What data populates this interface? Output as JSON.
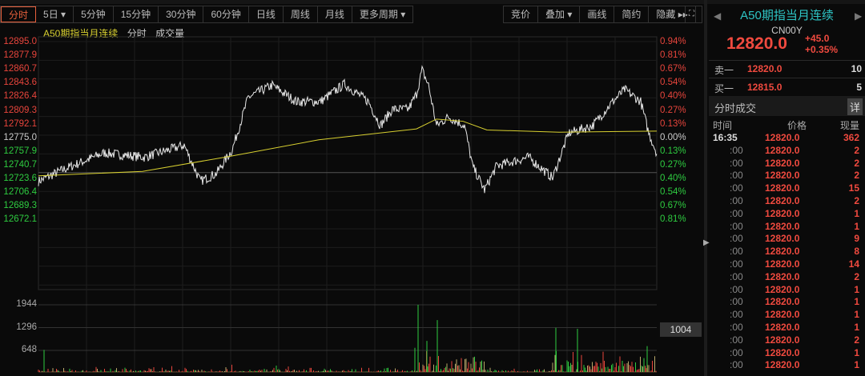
{
  "toolbar": {
    "periods": [
      "分时",
      "5日 ▾",
      "5分钟",
      "15分钟",
      "30分钟",
      "60分钟",
      "日线",
      "周线",
      "月线",
      "更多周期 ▾"
    ],
    "tools": [
      "竞价",
      "叠加 ▾",
      "画线",
      "简约",
      "隐藏 ▸▸"
    ]
  },
  "legend": {
    "name": "A50期指当月连续",
    "mode": "分时",
    "volume": "成交量"
  },
  "price_axis": {
    "left": [
      "12895.0",
      "12877.9",
      "12860.7",
      "12843.6",
      "12826.4",
      "12809.3",
      "12792.1",
      "12775.0",
      "12757.9",
      "12740.7",
      "12723.6",
      "12706.4",
      "12689.3",
      "12672.1"
    ],
    "right": [
      "0.94%",
      "0.81%",
      "0.67%",
      "0.54%",
      "0.40%",
      "0.27%",
      "0.13%",
      "0.00%",
      "0.13%",
      "0.27%",
      "0.40%",
      "0.54%",
      "0.67%",
      "0.81%"
    ]
  },
  "volume_axis": [
    "1944",
    "1296",
    "648"
  ],
  "volume_readout": "1004",
  "colors": {
    "up": "#e8453c",
    "down": "#2ecc40",
    "price": "#e8e8e8",
    "avg": "#d8d030",
    "accent": "#2ec4c4"
  },
  "chart_data": {
    "type": "line",
    "prev_close": 12775.0,
    "price_range": [
      12672.1,
      12895.0
    ],
    "volume_max": 1944,
    "price_points": [
      [
        0,
        12767
      ],
      [
        32,
        12778
      ],
      [
        82,
        12793
      ],
      [
        132,
        12789
      ],
      [
        182,
        12800
      ],
      [
        202,
        12767
      ],
      [
        222,
        12774
      ],
      [
        242,
        12796
      ],
      [
        262,
        12844
      ],
      [
        292,
        12855
      ],
      [
        322,
        12840
      ],
      [
        352,
        12840
      ],
      [
        382,
        12856
      ],
      [
        412,
        12840
      ],
      [
        427,
        12818
      ],
      [
        442,
        12833
      ],
      [
        462,
        12833
      ],
      [
        472,
        12847
      ],
      [
        479,
        12869
      ],
      [
        487,
        12855
      ],
      [
        497,
        12818
      ],
      [
        512,
        12826
      ],
      [
        532,
        12818
      ],
      [
        542,
        12781
      ],
      [
        557,
        12759
      ],
      [
        572,
        12781
      ],
      [
        612,
        12789
      ],
      [
        642,
        12770
      ],
      [
        662,
        12811
      ],
      [
        692,
        12818
      ],
      [
        717,
        12840
      ],
      [
        732,
        12851
      ],
      [
        752,
        12840
      ],
      [
        762,
        12811
      ],
      [
        772,
        12793
      ]
    ],
    "avg_points": [
      [
        0,
        12772
      ],
      [
        130,
        12776
      ],
      [
        240,
        12790
      ],
      [
        350,
        12805
      ],
      [
        472,
        12815
      ],
      [
        497,
        12824
      ],
      [
        530,
        12822
      ],
      [
        560,
        12814
      ],
      [
        650,
        12812
      ],
      [
        772,
        12813
      ]
    ],
    "volume_spikes": [
      [
        7,
        640
      ],
      [
        474,
        1944
      ],
      [
        498,
        1500
      ],
      [
        470,
        700
      ],
      [
        485,
        900
      ],
      [
        646,
        1280
      ],
      [
        673,
        1250
      ],
      [
        760,
        750
      ]
    ]
  },
  "panel": {
    "title": "A50期指当月连续",
    "code": "CN00Y",
    "price": "12820.0",
    "change": "+45.0",
    "change_pct": "+0.35%",
    "ask_label": "卖一",
    "ask_price": "12820.0",
    "ask_vol": "10",
    "bid_label": "买一",
    "bid_price": "12815.0",
    "bid_vol": "5",
    "trades_title": "分时成交",
    "detail": "详",
    "cols": [
      "时间",
      "价格",
      "现量"
    ],
    "trades": [
      [
        "16:35",
        "12820.0",
        "362"
      ],
      [
        ":00",
        "12820.0",
        "2"
      ],
      [
        ":00",
        "12820.0",
        "2"
      ],
      [
        ":00",
        "12820.0",
        "2"
      ],
      [
        ":00",
        "12820.0",
        "15"
      ],
      [
        ":00",
        "12820.0",
        "2"
      ],
      [
        ":00",
        "12820.0",
        "1"
      ],
      [
        ":00",
        "12820.0",
        "1"
      ],
      [
        ":00",
        "12820.0",
        "9"
      ],
      [
        ":00",
        "12820.0",
        "8"
      ],
      [
        ":00",
        "12820.0",
        "14"
      ],
      [
        ":00",
        "12820.0",
        "2"
      ],
      [
        ":00",
        "12820.0",
        "1"
      ],
      [
        ":00",
        "12820.0",
        "1"
      ],
      [
        ":00",
        "12820.0",
        "1"
      ],
      [
        ":00",
        "12820.0",
        "1"
      ],
      [
        ":00",
        "12820.0",
        "2"
      ],
      [
        ":00",
        "12820.0",
        "1"
      ],
      [
        ":00",
        "12820.0",
        "1"
      ]
    ]
  }
}
